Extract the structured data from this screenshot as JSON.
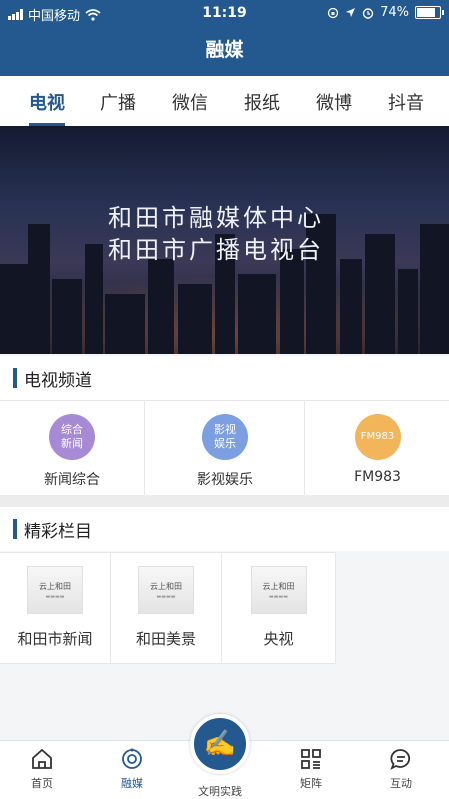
{
  "status_bar": {
    "carrier": "中国移动",
    "time": "11:19",
    "battery": "74%",
    "battery_level": 0.74,
    "icons": [
      "signal-icon",
      "wifi-icon",
      "orientation-lock-icon",
      "location-icon",
      "alarm-icon",
      "battery-icon"
    ]
  },
  "header": {
    "title": "融媒"
  },
  "tabs": [
    {
      "label": "电视",
      "active": true
    },
    {
      "label": "广播",
      "active": false
    },
    {
      "label": "微信",
      "active": false
    },
    {
      "label": "报纸",
      "active": false
    },
    {
      "label": "微博",
      "active": false
    },
    {
      "label": "抖音",
      "active": false
    }
  ],
  "banner": {
    "line1": "和田市融媒体中心",
    "line2": "和田市广播电视台"
  },
  "tv_channels": {
    "title": "电视频道",
    "items": [
      {
        "badge": "综合新闻",
        "name": "新闻综合",
        "color": "#a68ad6"
      },
      {
        "badge": "影视娱乐",
        "name": "影视娱乐",
        "color": "#7b9fe0"
      },
      {
        "badge": "FM983",
        "name": "FM983",
        "color": "#f2b55a"
      }
    ]
  },
  "columns": {
    "title": "精彩栏目",
    "items": [
      {
        "thumb_title": "云上和田",
        "name": "和田市新闻"
      },
      {
        "thumb_title": "云上和田",
        "name": "和田美景"
      },
      {
        "thumb_title": "云上和田",
        "name": "央视"
      }
    ]
  },
  "tab_bar": [
    {
      "label": "首页",
      "icon": "home-icon",
      "active": false
    },
    {
      "label": "融媒",
      "icon": "media-icon",
      "active": true
    },
    {
      "label": "文明实践",
      "icon": "civilization-practice-icon",
      "active": false
    },
    {
      "label": "矩阵",
      "icon": "matrix-icon",
      "active": false
    },
    {
      "label": "互动",
      "icon": "chat-icon",
      "active": false
    }
  ],
  "colors": {
    "primary": "#23598f"
  }
}
